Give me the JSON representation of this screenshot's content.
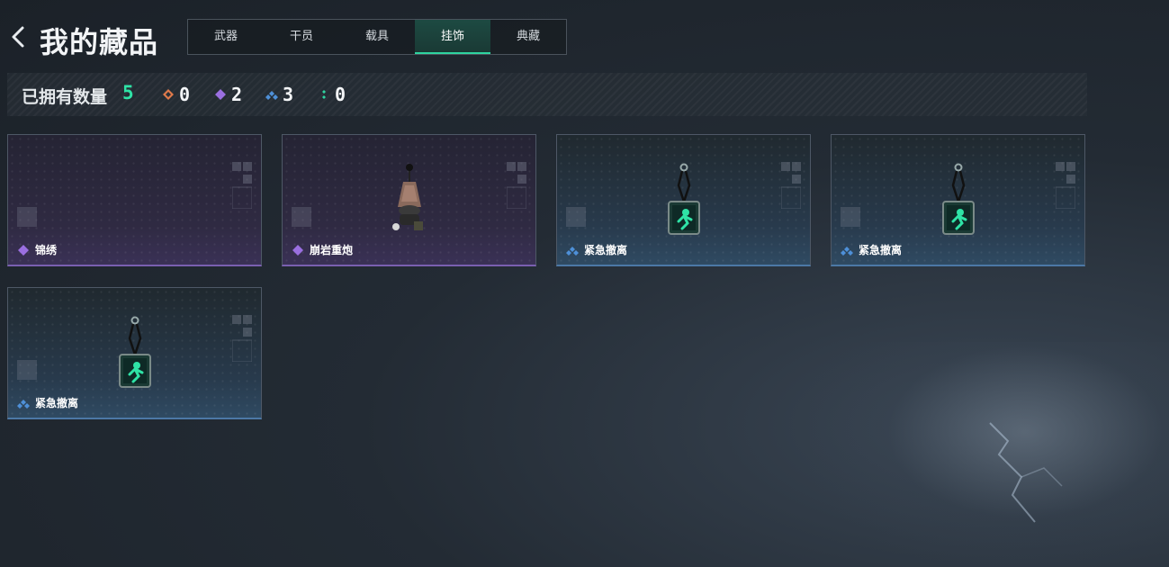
{
  "header": {
    "title": "我的藏品"
  },
  "tabs": [
    {
      "label": "武器"
    },
    {
      "label": "干员"
    },
    {
      "label": "载具"
    },
    {
      "label": "挂饰",
      "active": true
    },
    {
      "label": "典藏"
    }
  ],
  "stats": {
    "owned_label": "已拥有数量",
    "owned_count": "5",
    "rarities": [
      {
        "icon": "orange-diamond-icon",
        "color": "#e07a4a",
        "count": "0"
      },
      {
        "icon": "purple-diamond-icon",
        "color": "#9a6fe0",
        "count": "2"
      },
      {
        "icon": "blue-diamond-icon",
        "color": "#4e90d8",
        "count": "3"
      },
      {
        "icon": "green-dots-icon",
        "color": "#2fd4a0",
        "count": "0"
      }
    ]
  },
  "items": [
    {
      "name": "锦绣",
      "rarity": "purple"
    },
    {
      "name": "崩岩重炮",
      "rarity": "purple"
    },
    {
      "name": "紧急撤离",
      "rarity": "blue"
    },
    {
      "name": "紧急撤离",
      "rarity": "blue"
    },
    {
      "name": "紧急撤离",
      "rarity": "blue"
    }
  ]
}
